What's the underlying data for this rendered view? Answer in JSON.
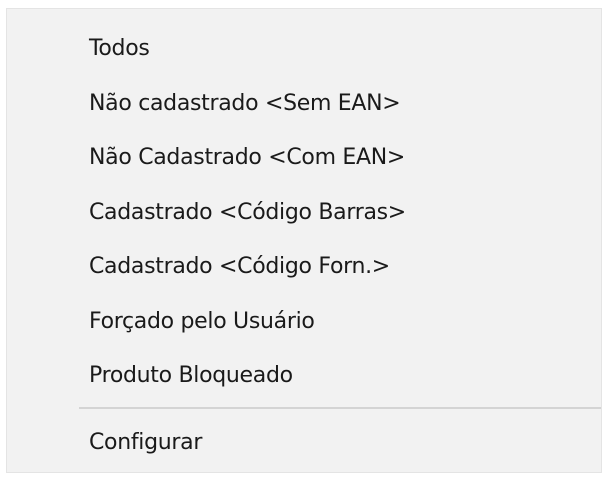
{
  "menu": {
    "items": [
      {
        "label": "Todos"
      },
      {
        "label": "Não cadastrado <Sem EAN>"
      },
      {
        "label": "Não Cadastrado <Com EAN>"
      },
      {
        "label": "Cadastrado <Código Barras>"
      },
      {
        "label": "Cadastrado <Código Forn.>"
      },
      {
        "label": "Forçado pelo Usuário"
      },
      {
        "label": "Produto Bloqueado"
      }
    ],
    "footer": {
      "label": "Configurar"
    }
  }
}
